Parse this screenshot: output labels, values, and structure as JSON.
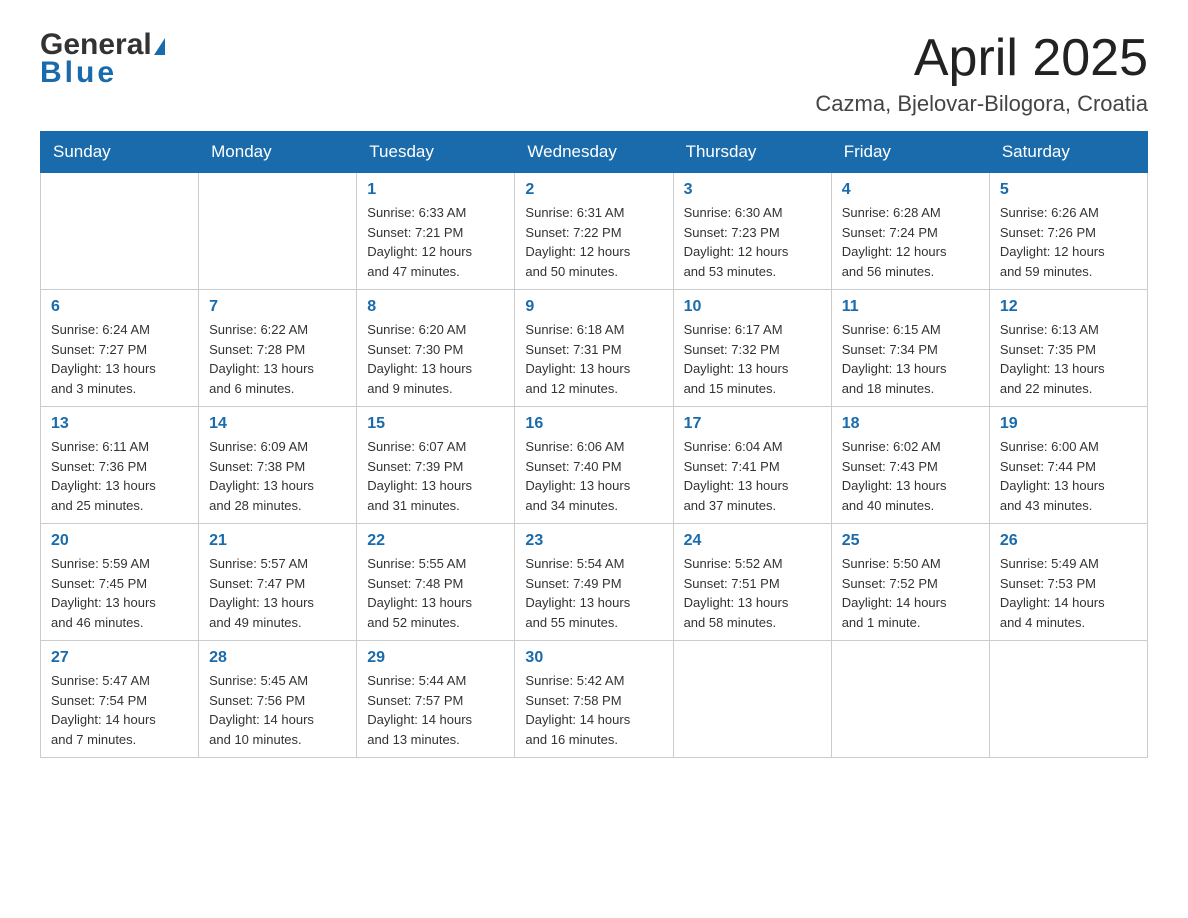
{
  "header": {
    "title": "April 2025",
    "subtitle": "Cazma, Bjelovar-Bilogora, Croatia",
    "logo_line1": "General",
    "logo_line2": "Blue"
  },
  "weekdays": [
    "Sunday",
    "Monday",
    "Tuesday",
    "Wednesday",
    "Thursday",
    "Friday",
    "Saturday"
  ],
  "weeks": [
    [
      {
        "day": "",
        "info": ""
      },
      {
        "day": "",
        "info": ""
      },
      {
        "day": "1",
        "info": "Sunrise: 6:33 AM\nSunset: 7:21 PM\nDaylight: 12 hours\nand 47 minutes."
      },
      {
        "day": "2",
        "info": "Sunrise: 6:31 AM\nSunset: 7:22 PM\nDaylight: 12 hours\nand 50 minutes."
      },
      {
        "day": "3",
        "info": "Sunrise: 6:30 AM\nSunset: 7:23 PM\nDaylight: 12 hours\nand 53 minutes."
      },
      {
        "day": "4",
        "info": "Sunrise: 6:28 AM\nSunset: 7:24 PM\nDaylight: 12 hours\nand 56 minutes."
      },
      {
        "day": "5",
        "info": "Sunrise: 6:26 AM\nSunset: 7:26 PM\nDaylight: 12 hours\nand 59 minutes."
      }
    ],
    [
      {
        "day": "6",
        "info": "Sunrise: 6:24 AM\nSunset: 7:27 PM\nDaylight: 13 hours\nand 3 minutes."
      },
      {
        "day": "7",
        "info": "Sunrise: 6:22 AM\nSunset: 7:28 PM\nDaylight: 13 hours\nand 6 minutes."
      },
      {
        "day": "8",
        "info": "Sunrise: 6:20 AM\nSunset: 7:30 PM\nDaylight: 13 hours\nand 9 minutes."
      },
      {
        "day": "9",
        "info": "Sunrise: 6:18 AM\nSunset: 7:31 PM\nDaylight: 13 hours\nand 12 minutes."
      },
      {
        "day": "10",
        "info": "Sunrise: 6:17 AM\nSunset: 7:32 PM\nDaylight: 13 hours\nand 15 minutes."
      },
      {
        "day": "11",
        "info": "Sunrise: 6:15 AM\nSunset: 7:34 PM\nDaylight: 13 hours\nand 18 minutes."
      },
      {
        "day": "12",
        "info": "Sunrise: 6:13 AM\nSunset: 7:35 PM\nDaylight: 13 hours\nand 22 minutes."
      }
    ],
    [
      {
        "day": "13",
        "info": "Sunrise: 6:11 AM\nSunset: 7:36 PM\nDaylight: 13 hours\nand 25 minutes."
      },
      {
        "day": "14",
        "info": "Sunrise: 6:09 AM\nSunset: 7:38 PM\nDaylight: 13 hours\nand 28 minutes."
      },
      {
        "day": "15",
        "info": "Sunrise: 6:07 AM\nSunset: 7:39 PM\nDaylight: 13 hours\nand 31 minutes."
      },
      {
        "day": "16",
        "info": "Sunrise: 6:06 AM\nSunset: 7:40 PM\nDaylight: 13 hours\nand 34 minutes."
      },
      {
        "day": "17",
        "info": "Sunrise: 6:04 AM\nSunset: 7:41 PM\nDaylight: 13 hours\nand 37 minutes."
      },
      {
        "day": "18",
        "info": "Sunrise: 6:02 AM\nSunset: 7:43 PM\nDaylight: 13 hours\nand 40 minutes."
      },
      {
        "day": "19",
        "info": "Sunrise: 6:00 AM\nSunset: 7:44 PM\nDaylight: 13 hours\nand 43 minutes."
      }
    ],
    [
      {
        "day": "20",
        "info": "Sunrise: 5:59 AM\nSunset: 7:45 PM\nDaylight: 13 hours\nand 46 minutes."
      },
      {
        "day": "21",
        "info": "Sunrise: 5:57 AM\nSunset: 7:47 PM\nDaylight: 13 hours\nand 49 minutes."
      },
      {
        "day": "22",
        "info": "Sunrise: 5:55 AM\nSunset: 7:48 PM\nDaylight: 13 hours\nand 52 minutes."
      },
      {
        "day": "23",
        "info": "Sunrise: 5:54 AM\nSunset: 7:49 PM\nDaylight: 13 hours\nand 55 minutes."
      },
      {
        "day": "24",
        "info": "Sunrise: 5:52 AM\nSunset: 7:51 PM\nDaylight: 13 hours\nand 58 minutes."
      },
      {
        "day": "25",
        "info": "Sunrise: 5:50 AM\nSunset: 7:52 PM\nDaylight: 14 hours\nand 1 minute."
      },
      {
        "day": "26",
        "info": "Sunrise: 5:49 AM\nSunset: 7:53 PM\nDaylight: 14 hours\nand 4 minutes."
      }
    ],
    [
      {
        "day": "27",
        "info": "Sunrise: 5:47 AM\nSunset: 7:54 PM\nDaylight: 14 hours\nand 7 minutes."
      },
      {
        "day": "28",
        "info": "Sunrise: 5:45 AM\nSunset: 7:56 PM\nDaylight: 14 hours\nand 10 minutes."
      },
      {
        "day": "29",
        "info": "Sunrise: 5:44 AM\nSunset: 7:57 PM\nDaylight: 14 hours\nand 13 minutes."
      },
      {
        "day": "30",
        "info": "Sunrise: 5:42 AM\nSunset: 7:58 PM\nDaylight: 14 hours\nand 16 minutes."
      },
      {
        "day": "",
        "info": ""
      },
      {
        "day": "",
        "info": ""
      },
      {
        "day": "",
        "info": ""
      }
    ]
  ]
}
